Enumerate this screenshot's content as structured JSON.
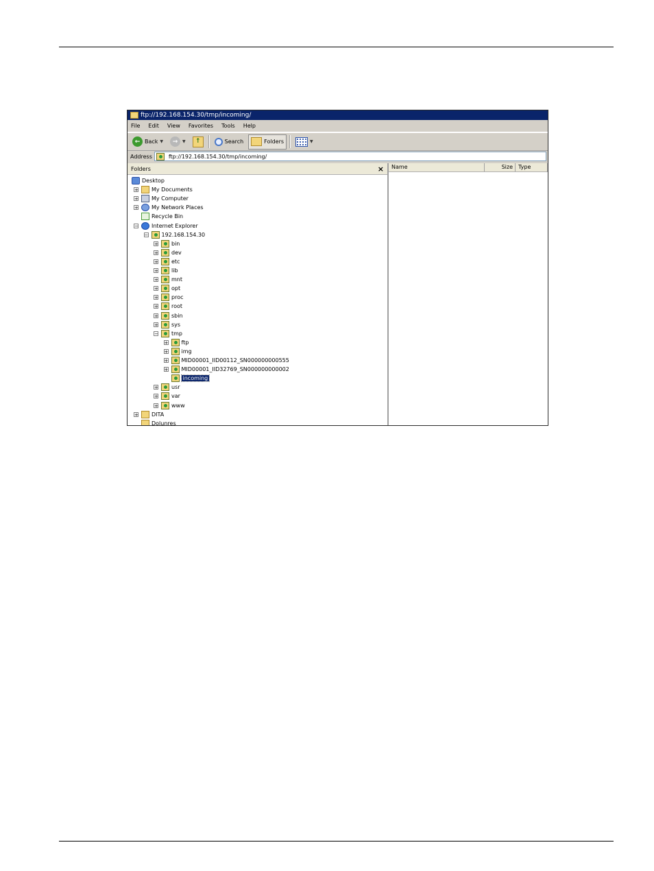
{
  "window": {
    "title": "ftp://192.168.154.30/tmp/incoming/"
  },
  "menu": [
    "File",
    "Edit",
    "View",
    "Favorites",
    "Tools",
    "Help"
  ],
  "toolbar": {
    "back_label": "Back",
    "search_label": "Search",
    "folders_label": "Folders"
  },
  "address": {
    "label": "Address",
    "value": "ftp://192.168.154.30/tmp/incoming/"
  },
  "folders_pane": {
    "title": "Folders",
    "close": "×"
  },
  "tree": [
    {
      "label": "Desktop",
      "icon": "desktop-icon",
      "expander": ""
    },
    {
      "label": "My Documents",
      "icon": "folder-icon",
      "expander": "+"
    },
    {
      "label": "My Computer",
      "icon": "computer-icon",
      "expander": "+"
    },
    {
      "label": "My Network Places",
      "icon": "network-icon",
      "expander": "+"
    },
    {
      "label": "Recycle Bin",
      "icon": "recycle-bin-icon",
      "expander": ""
    },
    {
      "label": "Internet Explorer",
      "icon": "ie-icon",
      "expander": "−"
    },
    {
      "label": "192.168.154.30",
      "icon": "ftp-folder-icon",
      "expander": "−"
    },
    {
      "label": "bin",
      "icon": "ftp-folder-icon",
      "expander": "+"
    },
    {
      "label": "dev",
      "icon": "ftp-folder-icon",
      "expander": "+"
    },
    {
      "label": "etc",
      "icon": "ftp-folder-icon",
      "expander": "+"
    },
    {
      "label": "lib",
      "icon": "ftp-folder-icon",
      "expander": "+"
    },
    {
      "label": "mnt",
      "icon": "ftp-folder-icon",
      "expander": "+"
    },
    {
      "label": "opt",
      "icon": "ftp-folder-icon",
      "expander": "+"
    },
    {
      "label": "proc",
      "icon": "ftp-folder-icon",
      "expander": "+"
    },
    {
      "label": "root",
      "icon": "ftp-folder-icon",
      "expander": "+"
    },
    {
      "label": "sbin",
      "icon": "ftp-folder-icon",
      "expander": "+"
    },
    {
      "label": "sys",
      "icon": "ftp-folder-icon",
      "expander": "+"
    },
    {
      "label": "tmp",
      "icon": "ftp-folder-icon",
      "expander": "−"
    },
    {
      "label": "ftp",
      "icon": "ftp-folder-icon",
      "expander": "+"
    },
    {
      "label": "img",
      "icon": "ftp-folder-icon",
      "expander": "+"
    },
    {
      "label": "MID00001_IID00112_SN000000000555",
      "icon": "ftp-folder-icon",
      "expander": "+"
    },
    {
      "label": "MID00001_IID32769_SN000000000002",
      "icon": "ftp-folder-icon",
      "expander": "+"
    },
    {
      "label": "incoming",
      "icon": "ftp-folder-icon",
      "expander": ""
    },
    {
      "label": "usr",
      "icon": "ftp-folder-icon",
      "expander": "+"
    },
    {
      "label": "var",
      "icon": "ftp-folder-icon",
      "expander": "+"
    },
    {
      "label": "www",
      "icon": "ftp-folder-icon",
      "expander": "+"
    },
    {
      "label": "DITA",
      "icon": "folder-icon",
      "expander": "+"
    },
    {
      "label": "Dolunres",
      "icon": "folder-icon",
      "expander": ""
    }
  ],
  "file_list": {
    "columns": [
      "Name",
      "Size",
      "Type"
    ]
  }
}
